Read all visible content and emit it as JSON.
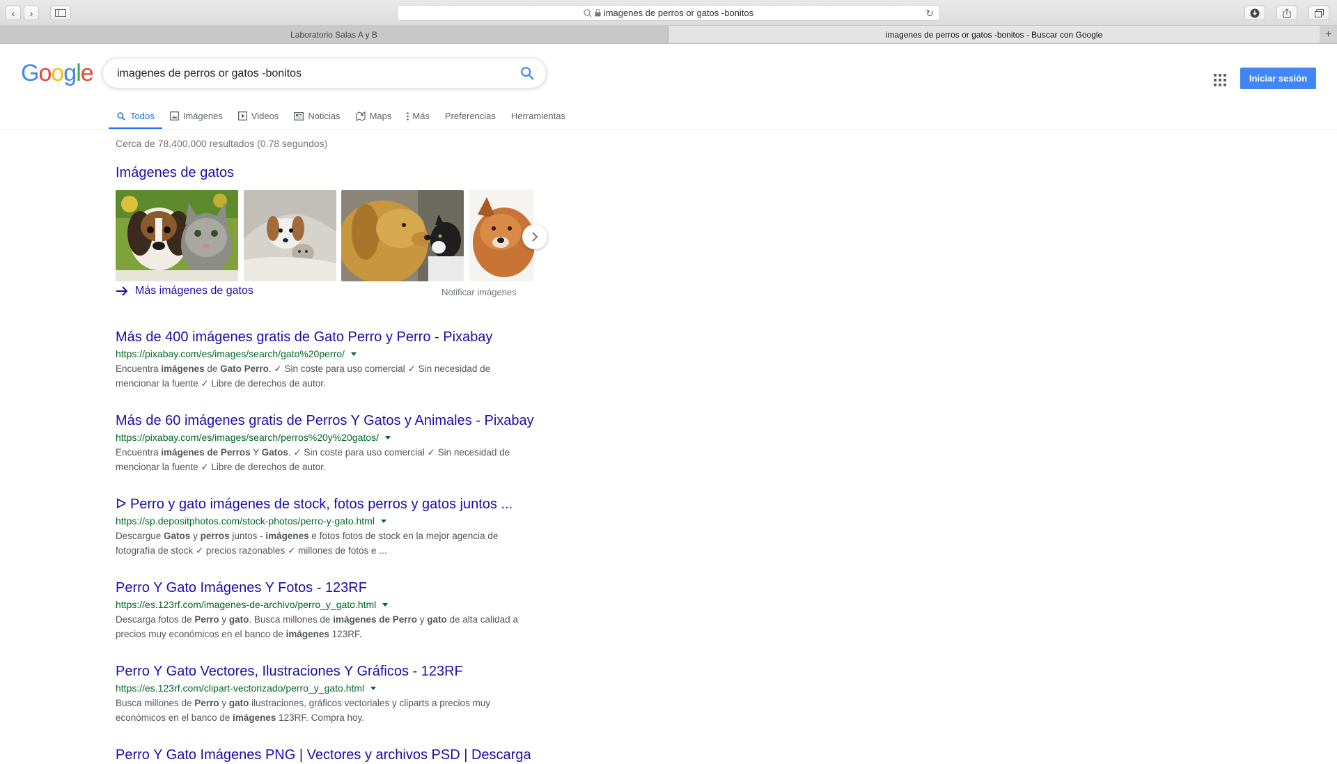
{
  "browser": {
    "url_text": "imagenes de perros or gatos -bonitos",
    "tabs": [
      {
        "label": "Laboratorio Salas A y B"
      },
      {
        "label": "imagenes de perros or gatos -bonitos - Buscar con Google"
      }
    ],
    "new_tab_symbol": "+"
  },
  "google": {
    "logo_letters": [
      "G",
      "o",
      "o",
      "g",
      "l",
      "e"
    ],
    "logo_colors": [
      "#4285f4",
      "#ea4335",
      "#fbbc05",
      "#4285f4",
      "#34a853",
      "#ea4335"
    ],
    "query": "imagenes de perros or gatos -bonitos",
    "signin_label": "Iniciar sesión"
  },
  "nav": {
    "items": [
      {
        "label": "Todos",
        "icon": "search-icon"
      },
      {
        "label": "Imágenes",
        "icon": "image-icon"
      },
      {
        "label": "Videos",
        "icon": "video-icon"
      },
      {
        "label": "Noticias",
        "icon": "news-icon"
      },
      {
        "label": "Maps",
        "icon": "map-icon"
      },
      {
        "label": "Más",
        "icon": "more-vertical-icon"
      },
      {
        "label": "Preferencias"
      },
      {
        "label": "Herramientas"
      }
    ]
  },
  "stats": "Cerca de 78,400,000 resultados (0.78 segundos)",
  "image_pack": {
    "header": "Imágenes de gatos",
    "more_label": "Más imágenes de gatos",
    "notify_label": "Notificar imágenes"
  },
  "results": [
    {
      "title": "Más de 400 imágenes gratis de Gato Perro y Perro - Pixabay",
      "url": "https://pixabay.com/es/images/search/gato%20perro/",
      "snippet_line1": [
        "Encuentra ",
        "imágenes",
        " de ",
        "Gato Perro",
        ". ✓ Sin coste para uso comercial ✓ Sin necesidad de"
      ],
      "snippet_line2": "mencionar la fuente ✓ Libre de derechos de autor."
    },
    {
      "title": "Más de 60 imágenes gratis de Perros Y Gatos y Animales - Pixabay",
      "url": "https://pixabay.com/es/images/search/perros%20y%20gatos/",
      "snippet_line1": [
        "Encuentra ",
        "imágenes de Perros",
        " Y ",
        "Gatos",
        ". ✓ Sin coste para uso comercial ✓ Sin necesidad de"
      ],
      "snippet_line2": "mencionar la fuente ✓ Libre de derechos de autor."
    },
    {
      "title": "ᐅ Perro y gato imágenes de stock, fotos perros y gatos juntos ...",
      "url": "https://sp.depositphotos.com/stock-photos/perro-y-gato.html",
      "snippet_line1": [
        "Descargue ",
        "Gatos",
        " y ",
        "perros",
        " juntos - ",
        "imágenes",
        " e fotos fotos de stock en la mejor agencia de"
      ],
      "snippet_line2": "fotografía de stock ✓ precios razonables ✓ millones de fotos e ..."
    },
    {
      "title": "Perro Y Gato Imágenes Y Fotos - 123RF",
      "url": "https://es.123rf.com/imagenes-de-archivo/perro_y_gato.html",
      "snippet_line1": [
        "Descarga fotos de ",
        "Perro",
        " y ",
        "gato",
        ". Busca millones de ",
        "imágenes de Perro",
        " y ",
        "gato",
        " de alta calidad a"
      ],
      "snippet_line2_parts": [
        "precios muy económicos en el banco de ",
        "imágenes",
        " 123RF."
      ]
    },
    {
      "title": "Perro Y Gato Vectores, Ilustraciones Y Gráficos - 123RF",
      "url": "https://es.123rf.com/clipart-vectorizado/perro_y_gato.html",
      "snippet_line1": [
        "Busca millones de ",
        "Perro",
        " y ",
        "gato",
        " ilustraciones, gráficos vectoriales y cliparts a precios muy"
      ],
      "snippet_line2_parts": [
        "económicos en el banco de ",
        "imágenes",
        " 123RF. Compra hoy."
      ]
    }
  ],
  "partial_result_title": "Perro Y Gato Imágenes PNG | Vectores y archivos PSD | Descarga"
}
